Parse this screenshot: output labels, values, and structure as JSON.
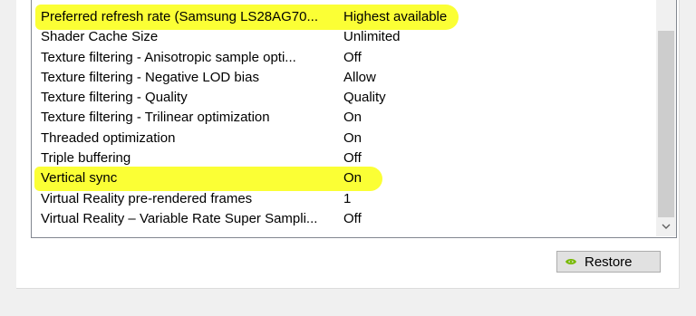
{
  "settings": {
    "rows": [
      {
        "name": "Preferred refresh rate (Samsung LS28AG70...",
        "value": "Highest available"
      },
      {
        "name": "Shader Cache Size",
        "value": "Unlimited"
      },
      {
        "name": "Texture filtering - Anisotropic sample opti...",
        "value": "Off"
      },
      {
        "name": "Texture filtering - Negative LOD bias",
        "value": "Allow"
      },
      {
        "name": "Texture filtering - Quality",
        "value": "Quality"
      },
      {
        "name": "Texture filtering - Trilinear optimization",
        "value": "On"
      },
      {
        "name": "Threaded optimization",
        "value": "On"
      },
      {
        "name": "Triple buffering",
        "value": "Off"
      },
      {
        "name": "Vertical sync",
        "value": "On"
      },
      {
        "name": "Virtual Reality pre-rendered frames",
        "value": "1"
      },
      {
        "name": "Virtual Reality – Variable Rate Super Sampli...",
        "value": "Off"
      }
    ]
  },
  "buttons": {
    "restore_label": "Restore"
  },
  "colors": {
    "highlight": "#fbff2a",
    "nvidia_green": "#76b900"
  },
  "icons": {
    "scroll_down": "chevron-down-icon",
    "restore_logo": "nvidia-logo-icon"
  }
}
